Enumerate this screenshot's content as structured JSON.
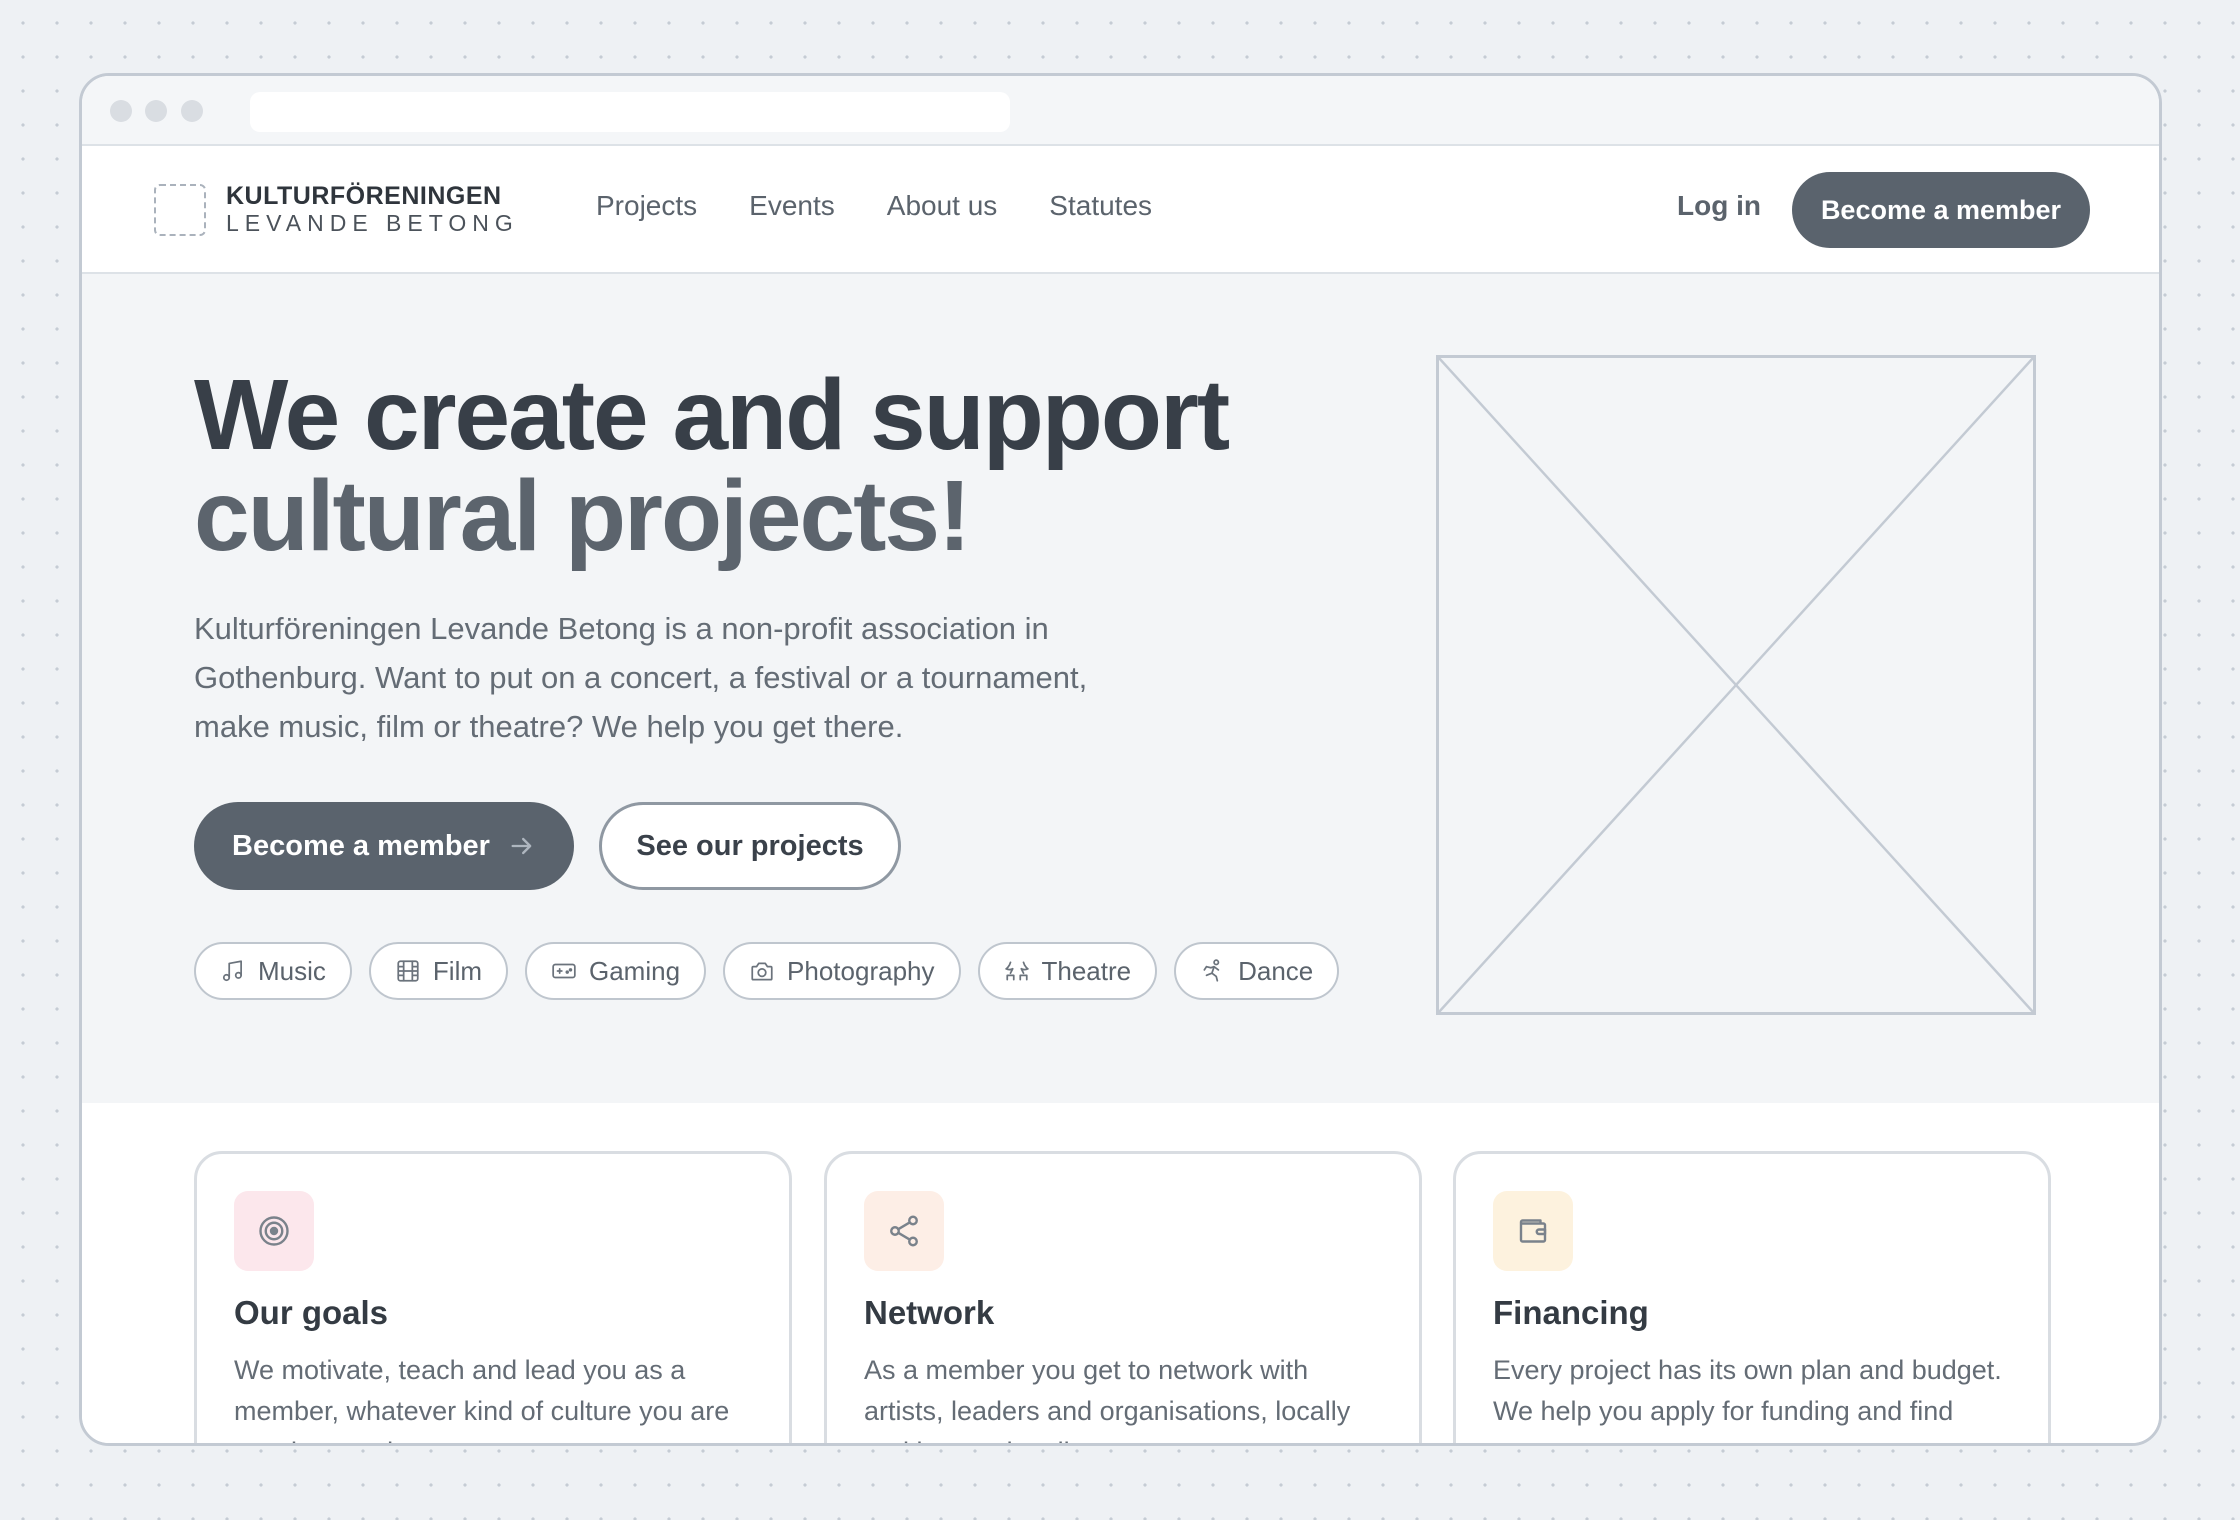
{
  "brand": {
    "name": "KULTURFÖRENINGEN",
    "subtitle": "LEVANDE BETONG"
  },
  "nav": {
    "links": [
      "Projects",
      "Events",
      "About us",
      "Statutes"
    ],
    "login": "Log in",
    "cta": "Become a member"
  },
  "hero": {
    "title_line1": "We create and support",
    "title_line2": "cultural projects!",
    "description": "Kulturföreningen Levande Betong is a non-profit association in Gothenburg. Want to put on a concert, a festival or a tournament, make music, film or theatre? We help you get there.",
    "primary_button": "Become a member",
    "secondary_button": "See our projects",
    "tags": [
      {
        "label": "Music",
        "icon": "music-note-icon"
      },
      {
        "label": "Film",
        "icon": "film-icon"
      },
      {
        "label": "Gaming",
        "icon": "gamepad-icon"
      },
      {
        "label": "Photography",
        "icon": "camera-icon"
      },
      {
        "label": "Theatre",
        "icon": "theatre-icon"
      },
      {
        "label": "Dance",
        "icon": "dance-icon"
      }
    ]
  },
  "cards": [
    {
      "title": "Our goals",
      "text": "We motivate, teach and lead you as a member, whatever kind of culture you are passionate about.",
      "icon": "target-icon",
      "icon_bg": "#fce7ec"
    },
    {
      "title": "Network",
      "text": "As a member you get to network with artists, leaders and organisations, locally and internationally.",
      "icon": "share-icon",
      "icon_bg": "#fdeee6"
    },
    {
      "title": "Financing",
      "text": "Every project has its own plan and budget. We help you apply for funding and find sponsors.",
      "icon": "wallet-icon",
      "icon_bg": "#fdf2de"
    }
  ],
  "colors": {
    "primary_button": "#5a636d",
    "heading_dark": "#383f48",
    "heading_muted": "#5c646d",
    "background": "#f3f5f7"
  }
}
